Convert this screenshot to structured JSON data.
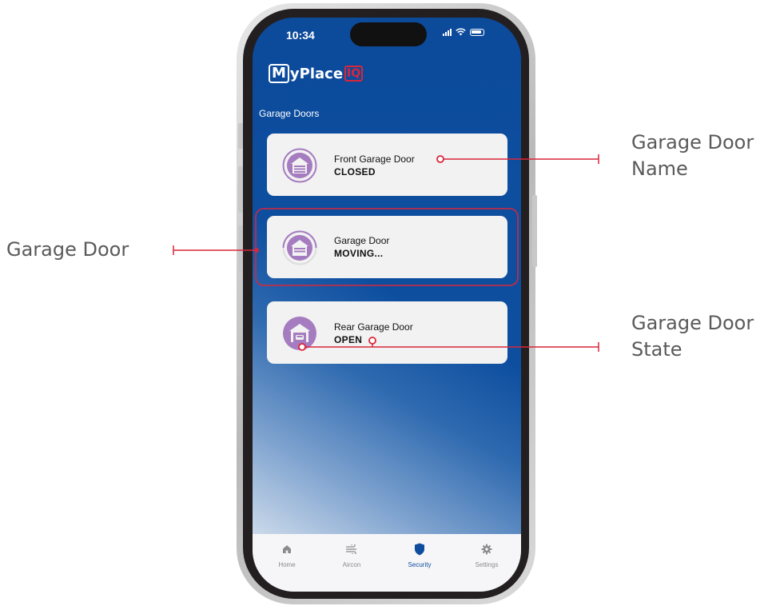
{
  "annotations": {
    "garage_door": "Garage Door",
    "garage_door_name_line1": "Garage Door",
    "garage_door_name_line2": "Name",
    "garage_door_state_line1": "Garage Door",
    "garage_door_state_line2": "State"
  },
  "status_bar": {
    "time": "10:34"
  },
  "app": {
    "logo_text": "MyPlace",
    "logo_iq": "IQ",
    "section_title": "Garage Doors"
  },
  "doors": [
    {
      "name": "Front Garage Door",
      "state": "CLOSED"
    },
    {
      "name": "Garage Door",
      "state": "MOVING..."
    },
    {
      "name": "Rear Garage Door",
      "state": "OPEN"
    }
  ],
  "nav": [
    {
      "label": "Home",
      "icon": "home-icon"
    },
    {
      "label": "Aircon",
      "icon": "aircon-icon"
    },
    {
      "label": "Security",
      "icon": "shield-icon"
    },
    {
      "label": "Settings",
      "icon": "gear-icon"
    }
  ],
  "colors": {
    "screen_blue": "#0d4e9f",
    "door_purple": "#a57cc0",
    "annotation_red": "#d9263a",
    "active_nav": "#0e4c9e"
  }
}
